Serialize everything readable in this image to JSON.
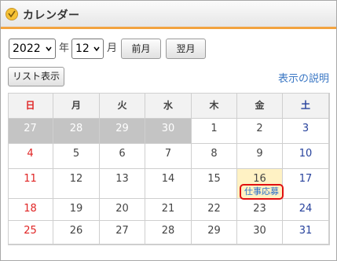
{
  "window": {
    "title": "カレンダー",
    "icon": "calendar-icon"
  },
  "controls": {
    "year_value": "2022",
    "year_unit": "年",
    "month_value": "12",
    "month_unit": "月",
    "prev_label": "前月",
    "next_label": "翌月"
  },
  "toolbar": {
    "list_label": "リスト表示",
    "help_label": "表示の説明"
  },
  "calendar": {
    "weekdays": [
      "日",
      "月",
      "火",
      "水",
      "木",
      "金",
      "土"
    ],
    "weeks": [
      [
        "27",
        "28",
        "29",
        "30",
        "1",
        "2",
        "3"
      ],
      [
        "4",
        "5",
        "6",
        "7",
        "8",
        "9",
        "10"
      ],
      [
        "11",
        "12",
        "13",
        "14",
        "15",
        "16",
        "17"
      ],
      [
        "18",
        "19",
        "20",
        "21",
        "22",
        "23",
        "24"
      ],
      [
        "25",
        "26",
        "27",
        "28",
        "29",
        "30",
        "31"
      ]
    ],
    "event": {
      "label": "仕事応募"
    }
  },
  "colors": {
    "accent_orange": "#f2a340",
    "sunday_red": "#e02424",
    "saturday_blue": "#27429c",
    "today_highlight": "#fff2c4",
    "event_outline": "#e01010",
    "link_blue": "#3a77c4"
  }
}
